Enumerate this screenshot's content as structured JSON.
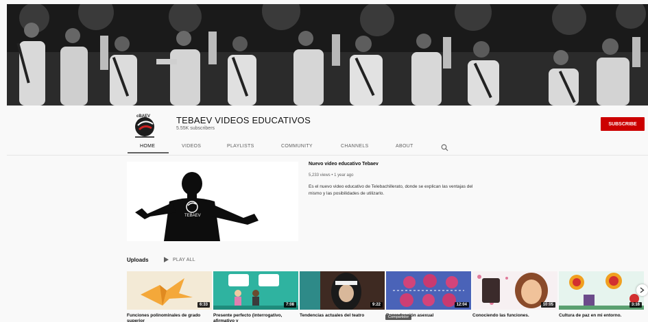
{
  "channel": {
    "name": "TEBAEV VIDEOS EDUCATIVOS",
    "subscribers": "5.55K subscribers",
    "subscribe_label": "SUBSCRIBE",
    "avatar_text": "cBAEV"
  },
  "tabs": [
    {
      "label": "HOME",
      "active": true
    },
    {
      "label": "VIDEOS",
      "active": false
    },
    {
      "label": "PLAYLISTS",
      "active": false
    },
    {
      "label": "COMMUNITY",
      "active": false
    },
    {
      "label": "CHANNELS",
      "active": false
    },
    {
      "label": "ABOUT",
      "active": false
    }
  ],
  "featured": {
    "title": "Nuevo video educativo Tebaev",
    "meta": "5,233 views • 1 year ago",
    "description": "Es el nuevo video educativo de Telebachillerato, donde se explican las ventajas del mismo y las posibilidades de utilizarlo.",
    "shirt_text": "TEBAEV"
  },
  "uploads": {
    "label": "Uploads",
    "play_all": "PLAY ALL",
    "videos": [
      {
        "title": "Funciones polinominales de grado superior",
        "duration": "6:33"
      },
      {
        "title": "Presente perfecto (interrogativo, afirmativo y",
        "duration": "7:08"
      },
      {
        "title": "Tendencias actuales del teatro",
        "duration": "9:22"
      },
      {
        "title": "Reproducción asexual",
        "duration": "12:04"
      },
      {
        "title": "Conociendo las funciones.",
        "duration": "10:05"
      },
      {
        "title": "Cultura de paz en mi entorno.",
        "duration": "3:16"
      }
    ]
  },
  "tooltip": "Compartidor",
  "colors": {
    "subscribe_red": "#cc0000",
    "background": "#f9f9f9"
  }
}
